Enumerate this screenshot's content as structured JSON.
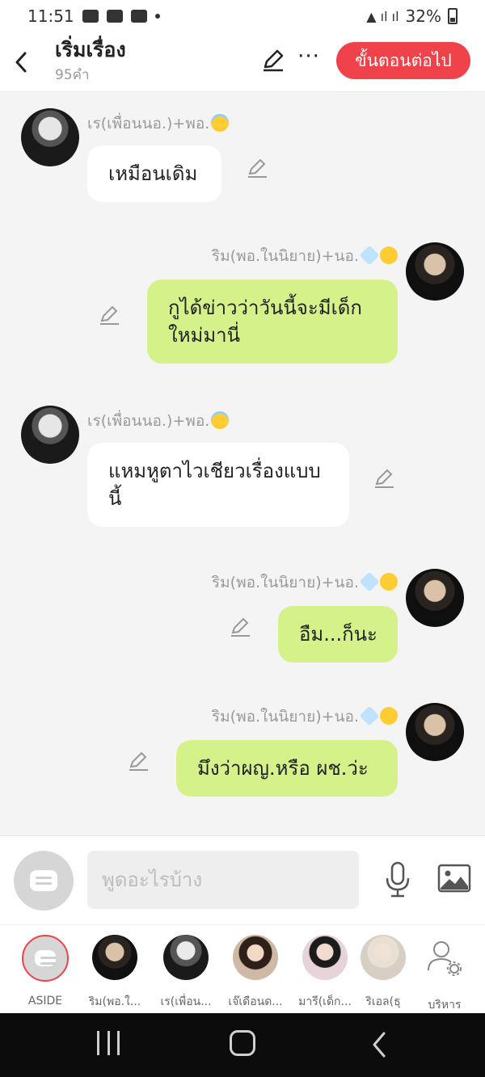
{
  "status_bar": {
    "time": "11:51",
    "battery": "32%"
  },
  "header": {
    "title": "เริ่มเรื่อง",
    "word_count": "95คำ",
    "next_button": "ขั้นตอนต่อไป"
  },
  "messages": [
    {
      "side": "left",
      "sender": "เร(เพื่อนนอ.)+พอ.",
      "text": "เหมือนเดิม"
    },
    {
      "side": "right",
      "sender": "ริม(พอ.ในนิยาย)+นอ.",
      "text": "กูได้ข่าวว่าวันนี้จะมีเด็กใหม่มานี่"
    },
    {
      "side": "left",
      "sender": "เร(เพื่อนนอ.)+พอ.",
      "text": "แหมหูตาไวเชียวเรื่องแบบนี้"
    },
    {
      "side": "right",
      "sender": "ริม(พอ.ในนิยาย)+นอ.",
      "text": "อืม...ก็นะ"
    },
    {
      "side": "right",
      "sender": "ริม(พอ.ในนิยาย)+นอ.",
      "text": "มึงว่าผญ.หรือ ผช.ว่ะ"
    }
  ],
  "composer": {
    "placeholder": "พูดอะไรบ้าง"
  },
  "characters": [
    {
      "label": "ASIDE"
    },
    {
      "label": "ริม(พอ.ใ..."
    },
    {
      "label": "เร(เพื่อน..."
    },
    {
      "label": "เจ๊เดือนด..."
    },
    {
      "label": "มารี(เด็ก..."
    },
    {
      "label": "ริเอล(ธุ"
    },
    {
      "label": "บริหาร"
    }
  ],
  "colors": {
    "accent": "#f0424a",
    "outgoing_bubble": "#d5f28a",
    "incoming_bubble": "#ffffff"
  }
}
